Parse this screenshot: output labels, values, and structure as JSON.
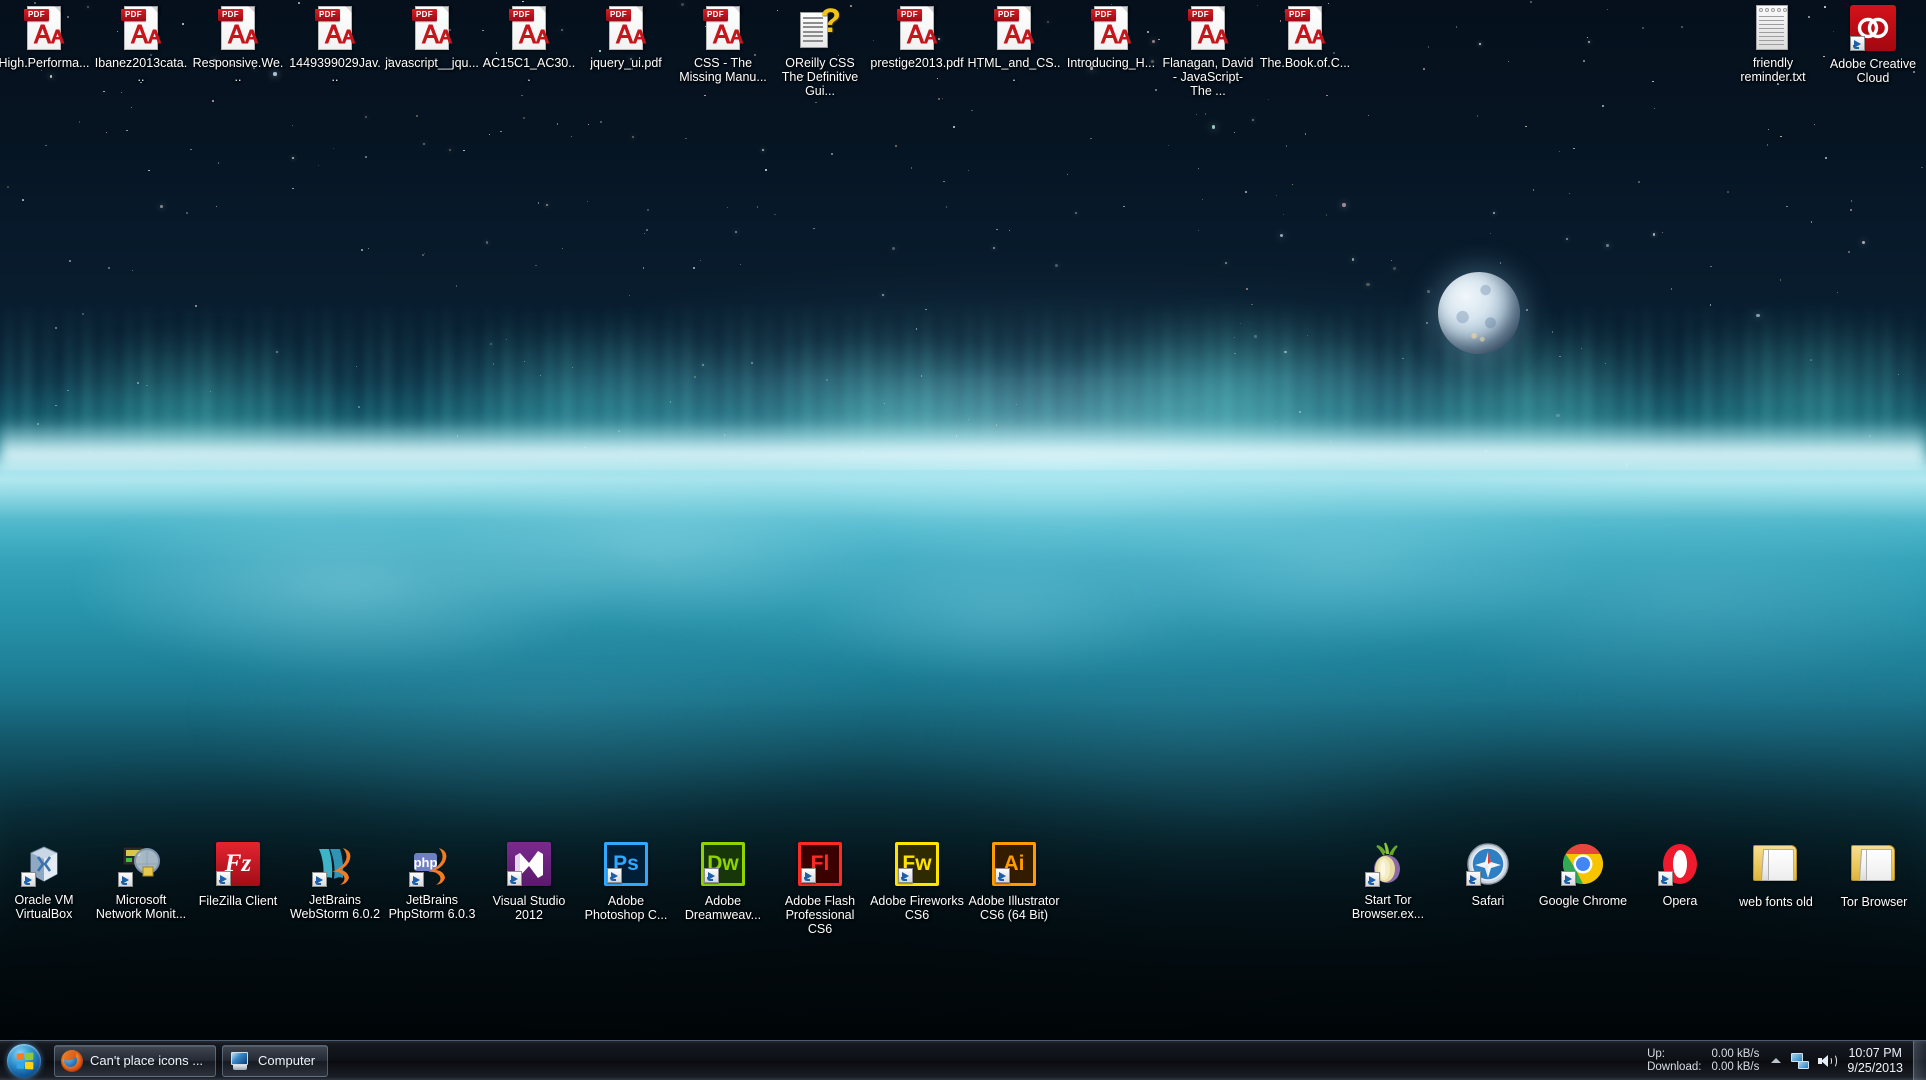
{
  "desktop": {
    "top_row_icons": [
      {
        "label": "High.Performa...",
        "type": "pdf"
      },
      {
        "label": "Ibanez2013cata...",
        "type": "pdf"
      },
      {
        "label": "Responsive.We...",
        "type": "pdf"
      },
      {
        "label": "1449399029Jav...",
        "type": "pdf"
      },
      {
        "label": "javascript__jqu...",
        "type": "pdf"
      },
      {
        "label": "AC15C1_AC30...",
        "type": "pdf"
      },
      {
        "label": "jquery_ui.pdf",
        "type": "pdf"
      },
      {
        "label": "CSS - The Missing Manu...",
        "type": "pdf"
      },
      {
        "label": "OReilly CSS The Definitive Gui...",
        "type": "help"
      },
      {
        "label": "prestige2013.pdf",
        "type": "pdf"
      },
      {
        "label": "HTML_and_CS...",
        "type": "pdf"
      },
      {
        "label": "Introducing_H...",
        "type": "pdf"
      },
      {
        "label": "Flanagan, David - JavaScript- The ...",
        "type": "pdf"
      },
      {
        "label": "The.Book.of.C...",
        "type": "pdf"
      }
    ],
    "top_right_icons": [
      {
        "label": "friendly reminder.txt",
        "type": "txt"
      },
      {
        "label": "Adobe Creative Cloud",
        "type": "creative-cloud",
        "color": "#d4121a"
      }
    ],
    "bottom_row_icons": [
      {
        "label": "Oracle VM VirtualBox",
        "type": "virtualbox"
      },
      {
        "label": "Microsoft Network Monit...",
        "type": "netmon"
      },
      {
        "label": "FileZilla Client",
        "type": "filezilla",
        "color": "#cc1122"
      },
      {
        "label": "JetBrains WebStorm 6.0.2",
        "type": "webstorm"
      },
      {
        "label": "JetBrains PhpStorm 6.0.3",
        "type": "phpstorm"
      },
      {
        "label": "Visual Studio 2012",
        "type": "visualstudio",
        "color": "#68217a"
      },
      {
        "label": "Adobe Photoshop C...",
        "type": "adobe",
        "glyph": "Ps",
        "color": "#31a8ff",
        "fill": "#001e36"
      },
      {
        "label": "Adobe Dreamweav...",
        "type": "adobe",
        "glyph": "Dw",
        "color": "#8fd400",
        "fill": "#17370a"
      },
      {
        "label": "Adobe Flash Professional CS6",
        "type": "adobe",
        "glyph": "Fl",
        "color": "#ff2a24",
        "fill": "#3b0000"
      },
      {
        "label": "Adobe Fireworks CS6",
        "type": "adobe",
        "glyph": "Fw",
        "color": "#ffe400",
        "fill": "#2f2a00"
      },
      {
        "label": "Adobe Illustrator CS6 (64 Bit)",
        "type": "adobe",
        "glyph": "Ai",
        "color": "#ff9a00",
        "fill": "#331b00"
      }
    ],
    "bottom_right_icons": [
      {
        "label": "Start Tor Browser.ex...",
        "type": "tor"
      },
      {
        "label": "Safari",
        "type": "safari"
      },
      {
        "label": "Google Chrome",
        "type": "chrome"
      },
      {
        "label": "Opera",
        "type": "opera",
        "color": "#ee1b2e"
      },
      {
        "label": "web fonts old",
        "type": "folder-open"
      },
      {
        "label": "Tor Browser",
        "type": "folder-open"
      }
    ]
  },
  "taskbar": {
    "start_button_label": "Start",
    "buttons": [
      {
        "label": "Can't place icons ...",
        "icon": "firefox-icon"
      },
      {
        "label": "Computer",
        "icon": "computer-icon"
      }
    ],
    "tray": {
      "net_up_label": "Up:",
      "net_down_label": "Download:",
      "net_up_value": "0.00 kB/s",
      "net_down_value": "0.00 kB/s",
      "show_hidden_icons": "Show hidden icons",
      "network_icon": "network-icon",
      "volume_icon": "volume-icon",
      "time": "10:07 PM",
      "date": "9/25/2013"
    }
  },
  "colors": {
    "taskbar_bg": "#0e1116",
    "label_text": "#ffffff",
    "accent": "#2f7fc4"
  }
}
